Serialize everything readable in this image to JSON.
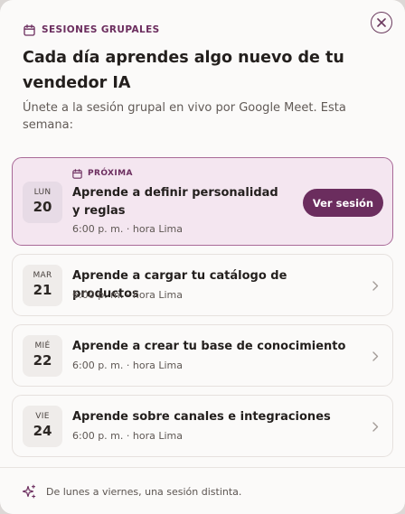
{
  "header": {
    "eyebrow": "SESIONES GRUPALES",
    "title": "Cada día aprendes algo nuevo de tu vendedor IA",
    "subtitle": "Únete a la sesión grupal en vivo por Google Meet. Esta semana:"
  },
  "sessions": [
    {
      "badge": "PRÓXIMA",
      "day_of_week": "LUN",
      "day": "20",
      "title": "Aprende a definir personalidad y reglas",
      "time": "6:00 p. m. · hora Lima",
      "action": "Ver sesión"
    },
    {
      "day_of_week": "MAR",
      "day": "21",
      "title": "Aprende a cargar tu catálogo de productos",
      "time": "6:00 p. m. · hora Lima"
    },
    {
      "day_of_week": "MIÉ",
      "day": "22",
      "title": "Aprende a crear tu base de conocimiento",
      "time": "6:00 p. m. · hora Lima"
    },
    {
      "day_of_week": "VIE",
      "day": "24",
      "title": "Aprende sobre canales e integraciones",
      "time": "6:00 p. m. · hora Lima"
    }
  ],
  "footer": {
    "text": "De lunes a viernes, una sesión distinta."
  },
  "icons": [
    "close-icon",
    "calendar-icon",
    "chevron-right-icon",
    "sparkle-icon"
  ],
  "colors": {
    "accent": "#6b2d5e",
    "featured_bg": "#f4e6f0",
    "featured_border": "#a96a98"
  }
}
